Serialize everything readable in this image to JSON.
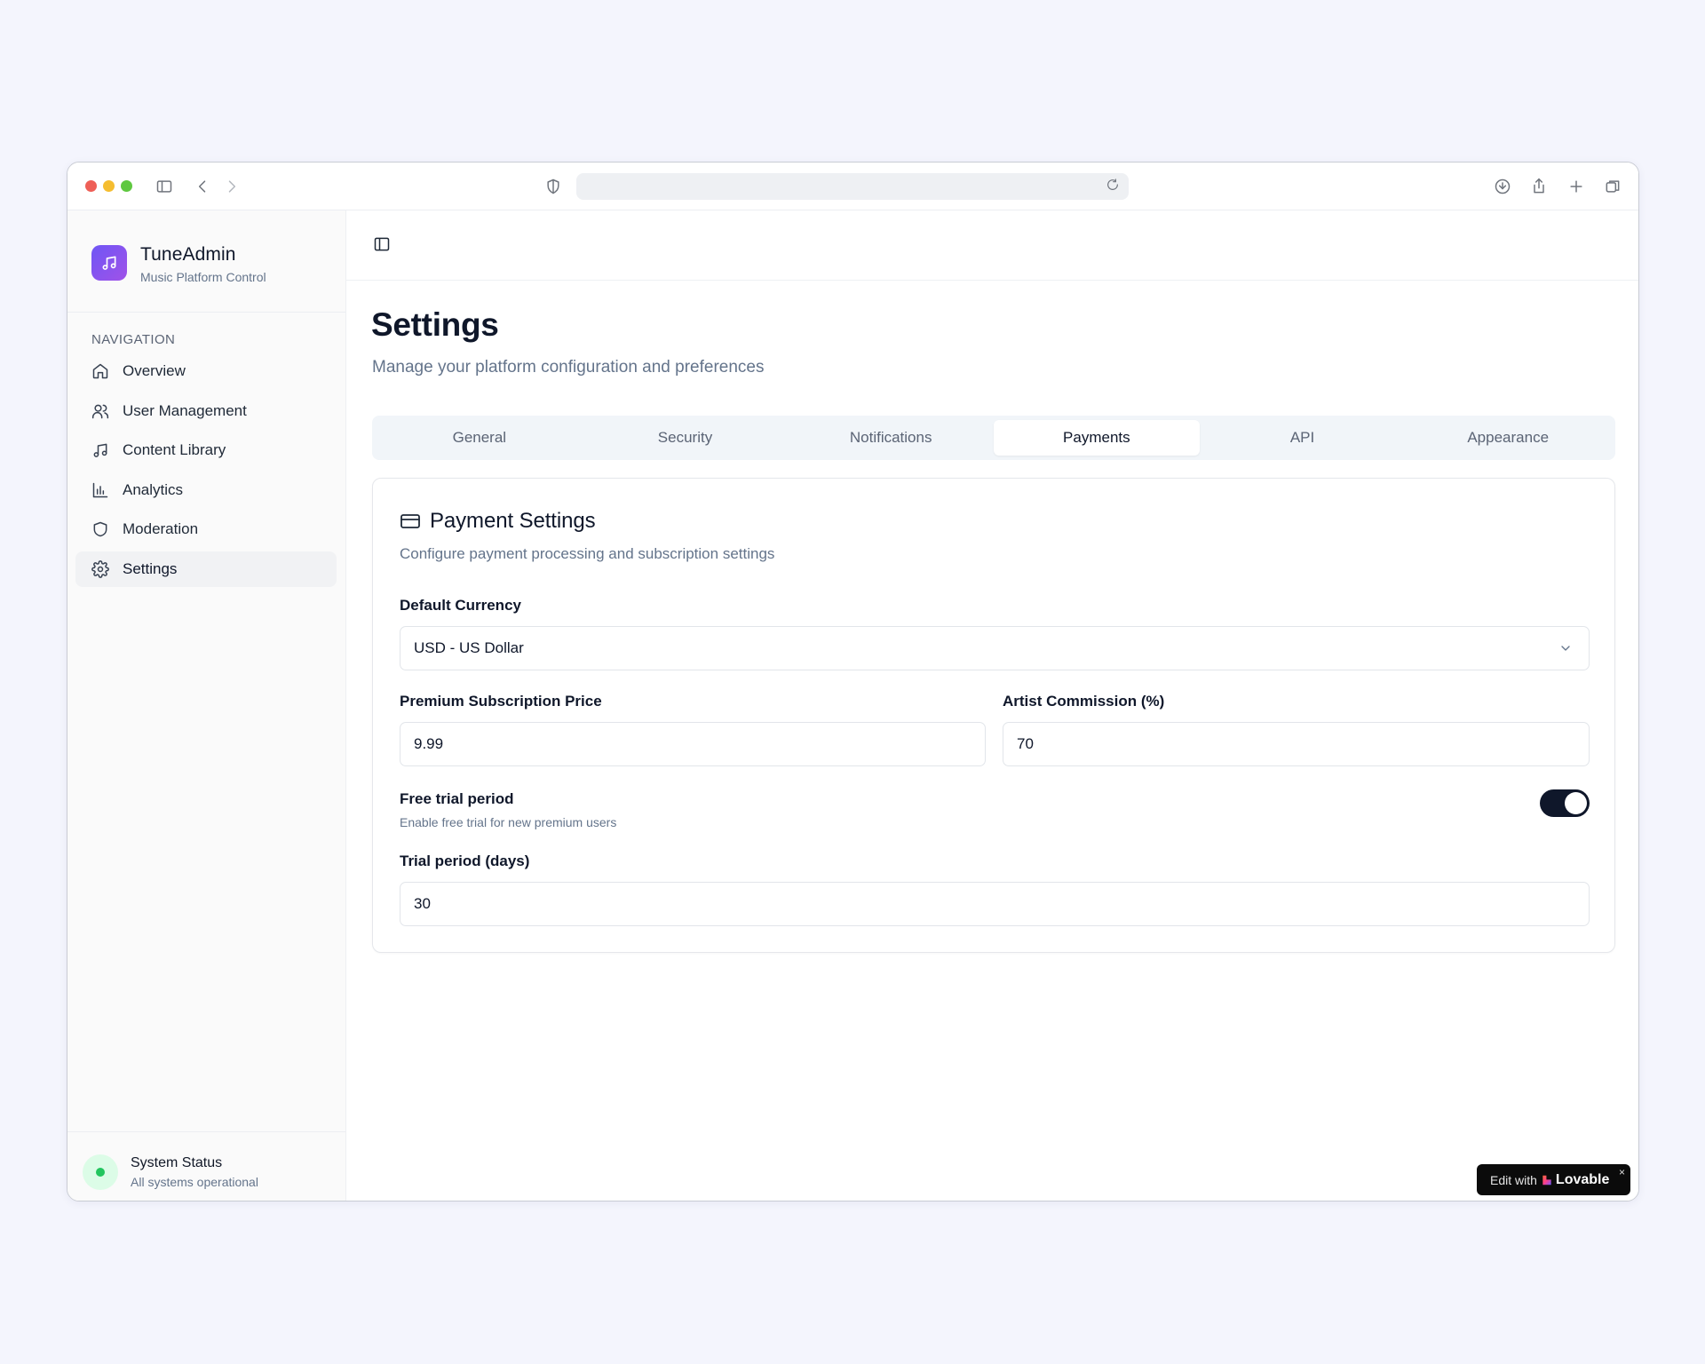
{
  "app": {
    "name": "TuneAdmin",
    "tagline": "Music Platform Control"
  },
  "sidebar": {
    "heading": "NAVIGATION",
    "items": [
      {
        "label": "Overview",
        "icon": "home-icon"
      },
      {
        "label": "User Management",
        "icon": "users-icon"
      },
      {
        "label": "Content Library",
        "icon": "music-note-icon"
      },
      {
        "label": "Analytics",
        "icon": "bar-chart-icon"
      },
      {
        "label": "Moderation",
        "icon": "shield-icon"
      },
      {
        "label": "Settings",
        "icon": "gear-icon",
        "active": true
      }
    ],
    "status": {
      "title": "System Status",
      "subtitle": "All systems operational"
    }
  },
  "page": {
    "title": "Settings",
    "subtitle": "Manage your platform configuration and preferences"
  },
  "tabs": [
    {
      "label": "General"
    },
    {
      "label": "Security"
    },
    {
      "label": "Notifications"
    },
    {
      "label": "Payments",
      "active": true
    },
    {
      "label": "API"
    },
    {
      "label": "Appearance"
    }
  ],
  "payment_card": {
    "title": "Payment Settings",
    "description": "Configure payment processing and subscription settings",
    "currency": {
      "label": "Default Currency",
      "value": "USD - US Dollar"
    },
    "premium_price": {
      "label": "Premium Subscription Price",
      "value": "9.99"
    },
    "commission": {
      "label": "Artist Commission (%)",
      "value": "70"
    },
    "free_trial": {
      "title": "Free trial period",
      "description": "Enable free trial for new premium users",
      "enabled": true
    },
    "trial_days": {
      "label": "Trial period (days)",
      "value": "30"
    }
  },
  "badge": {
    "prefix": "Edit with",
    "brand": "Lovable",
    "close": "×"
  },
  "colors": {
    "accent": "#0f172a",
    "brand_gradient_start": "#6f56f5",
    "brand_gradient_end": "#a052e8",
    "status_ok": "#22c55e"
  }
}
